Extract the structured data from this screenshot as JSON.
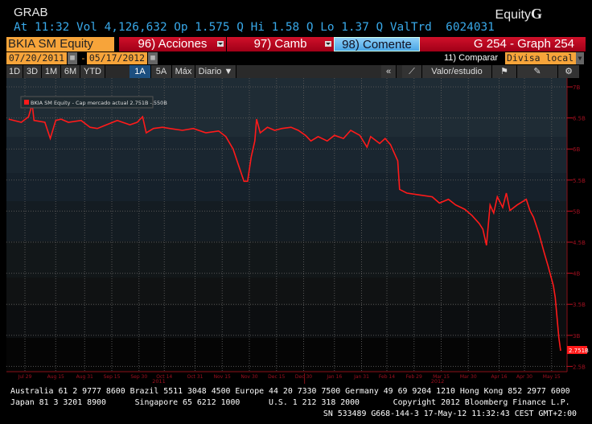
{
  "header": {
    "function": "GRAB",
    "market": "Equity",
    "market_key": "G",
    "quote": "At 11:32 Vol 4,126,632 Op 1.575 Q Hi 1.58 Q Lo 1.37 Q ValTrd  6024031"
  },
  "bar": {
    "ticker": "BKIA SM Equity",
    "actions": "96) Acciones",
    "change": "97) Camb",
    "comment": "98)  Comente",
    "graph": "G 254 - Graph 254"
  },
  "range": {
    "start": "07/20/2011",
    "sep": "-",
    "end": "05/17/2012",
    "compare": "11) Comparar",
    "currency": "Divisa local"
  },
  "toolbar": {
    "periods": [
      "1D",
      "3D",
      "1M",
      "6M",
      "YTD",
      "1A",
      "5A",
      "Máx"
    ],
    "active": "1A",
    "frequency": "Diario ▼",
    "collapse": "«",
    "study": "Valor/estudio"
  },
  "colors": {
    "line": "#ff1a1a",
    "axis": "#8a0f18",
    "orange": "#f7a43a"
  },
  "chart_data": {
    "type": "line",
    "legend": "BKIA SM Equity - Cap mercado actual  2.751B  -.550B",
    "last_value_label": "2.751B",
    "ylim": [
      2.35,
      7.13
    ],
    "yticks": [
      7,
      6.5,
      6,
      5.5,
      5,
      4.5,
      4,
      3.5,
      3,
      2.5
    ],
    "ytick_labels": [
      "7B",
      "6.5B",
      "6B",
      "5.5B",
      "5B",
      "4.5B",
      "4B",
      "3.5B",
      "3B",
      "2.5B"
    ],
    "x_unit": "days since 2011-07-20",
    "xticks": [
      9,
      26,
      42,
      57,
      72,
      86,
      103,
      118,
      133,
      148,
      163,
      180,
      195,
      209,
      224,
      239,
      254,
      271,
      285,
      300
    ],
    "xtick_labels": [
      "Jul 29",
      "Aug 15",
      "Aug 31",
      "Sep 15",
      "Sep 30",
      "Oct 14",
      "Oct 31",
      "Nov 15",
      "Nov 30",
      "Dec 15",
      "Dec 30",
      "Jan 16",
      "Jan 31",
      "Feb 14",
      "Feb 29",
      "Mar 15",
      "Mar 30",
      "Apr 16",
      "Apr 30",
      "May 15"
    ],
    "years": [
      {
        "label": "2011",
        "day": 83
      },
      {
        "label": "2012",
        "day": 237
      }
    ],
    "series": [
      {
        "name": "BKIA SM Equity - Cap mercado actual",
        "points": [
          [
            0,
            6.48
          ],
          [
            7,
            6.43
          ],
          [
            11,
            6.52
          ],
          [
            13,
            6.72
          ],
          [
            14,
            6.46
          ],
          [
            20,
            6.43
          ],
          [
            23,
            6.17
          ],
          [
            26,
            6.46
          ],
          [
            29,
            6.48
          ],
          [
            33,
            6.43
          ],
          [
            40,
            6.46
          ],
          [
            45,
            6.35
          ],
          [
            49,
            6.33
          ],
          [
            54,
            6.39
          ],
          [
            60,
            6.46
          ],
          [
            67,
            6.39
          ],
          [
            71,
            6.43
          ],
          [
            74,
            6.52
          ],
          [
            76,
            6.26
          ],
          [
            80,
            6.33
          ],
          [
            85,
            6.35
          ],
          [
            89,
            6.33
          ],
          [
            96,
            6.3
          ],
          [
            102,
            6.33
          ],
          [
            109,
            6.26
          ],
          [
            116,
            6.29
          ],
          [
            120,
            6.2
          ],
          [
            124,
            6.0
          ],
          [
            127,
            5.74
          ],
          [
            130,
            5.48
          ],
          [
            132,
            5.48
          ],
          [
            134,
            5.87
          ],
          [
            136,
            6.13
          ],
          [
            137,
            6.48
          ],
          [
            139,
            6.26
          ],
          [
            143,
            6.35
          ],
          [
            147,
            6.3
          ],
          [
            151,
            6.33
          ],
          [
            156,
            6.35
          ],
          [
            160,
            6.3
          ],
          [
            164,
            6.22
          ],
          [
            167,
            6.13
          ],
          [
            171,
            6.2
          ],
          [
            176,
            6.13
          ],
          [
            180,
            6.22
          ],
          [
            185,
            6.17
          ],
          [
            189,
            6.3
          ],
          [
            194,
            6.22
          ],
          [
            198,
            6.03
          ],
          [
            200,
            6.2
          ],
          [
            205,
            6.09
          ],
          [
            208,
            6.17
          ],
          [
            211,
            6.07
          ],
          [
            215,
            5.81
          ],
          [
            216,
            5.35
          ],
          [
            220,
            5.29
          ],
          [
            227,
            5.26
          ],
          [
            234,
            5.23
          ],
          [
            238,
            5.13
          ],
          [
            243,
            5.19
          ],
          [
            247,
            5.1
          ],
          [
            252,
            5.03
          ],
          [
            256,
            4.93
          ],
          [
            260,
            4.8
          ],
          [
            262,
            4.71
          ],
          [
            264,
            4.45
          ],
          [
            266,
            5.1
          ],
          [
            268,
            4.97
          ],
          [
            270,
            5.23
          ],
          [
            273,
            5.06
          ],
          [
            275,
            5.29
          ],
          [
            277,
            5.01
          ],
          [
            281,
            5.1
          ],
          [
            286,
            5.19
          ],
          [
            288,
            5.01
          ],
          [
            290,
            4.9
          ],
          [
            293,
            4.64
          ],
          [
            296,
            4.32
          ],
          [
            298,
            4.12
          ],
          [
            301,
            3.8
          ],
          [
            302,
            3.61
          ],
          [
            304,
            2.96
          ],
          [
            305,
            2.751
          ]
        ]
      }
    ]
  },
  "footer": {
    "line1": "Australia 61 2 9777 8600 Brazil 5511 3048 4500 Europe 44 20 7330 7500 Germany 49 69 9204 1210 Hong Kong 852 2977 6000",
    "line2": "Japan 81 3 3201 8900      Singapore 65 6212 1000      U.S. 1 212 318 2000       Copyright 2012 Bloomberg Finance L.P.",
    "line3": "                                                                    SN 533489 G668-144-3 17-May-12 11:32:43 CEST GMT+2:00"
  }
}
